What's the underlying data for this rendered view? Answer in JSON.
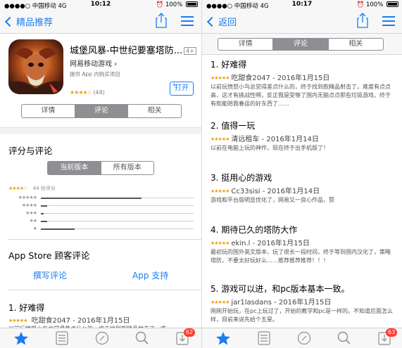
{
  "status_left": {
    "carrier": "●●●●○ 中国移动  4G",
    "time": "10:12",
    "battery": "100%"
  },
  "status_right": {
    "carrier": "●●●●○ 中国移动  4G",
    "time": "10:17",
    "battery": "100%"
  },
  "left": {
    "back_label": "精品推荐",
    "app": {
      "title": "城堡风暴-中世纪要塞塔防...",
      "age": "4+",
      "developer": "网易移动游戏 ›",
      "iap": "提供 App 内购买项目",
      "stars": "★★★★☆",
      "rating_count": "(44)",
      "open_label": "打开"
    },
    "tabs": [
      "详情",
      "评论",
      "相关"
    ],
    "ratings_heading": "评分与评论",
    "version_tabs": [
      "当前版本",
      "所有版本"
    ],
    "summary_stars": "★★★★☆",
    "summary_count": "44 份评分",
    "histogram": [
      {
        "stars": "★★★★★",
        "fraction": 0.66
      },
      {
        "stars": "★★★★",
        "fraction": 0.04
      },
      {
        "stars": "★★★",
        "fraction": 0.02
      },
      {
        "stars": "★★",
        "fraction": 0.04
      },
      {
        "stars": "★",
        "fraction": 0.22
      }
    ],
    "customer_reviews_heading": "App Store 顾客评论",
    "write_review": "撰写评论",
    "app_support": "App 支持",
    "review1_title": "1. 好难得",
    "review1_meta": "吃甜食2047 - 2016年1月15日",
    "review1_body_fragment": "以前玩愤怒小鸟总觉得差点什么的，终于找到款精品射击了。难"
  },
  "right": {
    "back_label": "返回",
    "tabs": [
      "详情",
      "评论",
      "相关"
    ],
    "reviews": [
      {
        "title": "1. 好难得",
        "meta": "吃甜食2047 - 2016年1月15日",
        "body": "以前玩愤怒小鸟总觉得差点什么的，终于找到款精品射击了。难度有点点高，这才有挑战性啊，反正我是受够了国内无脑点点那些垃圾游戏，终于有款能陪我春运的好东西了……"
      },
      {
        "title": "2. 值得一玩",
        "meta": "清远租车 - 2016年1月14日",
        "body": "以前在电脑上玩的神作，现在终于出手机版了！"
      },
      {
        "title": "3. 挺用心的游戏",
        "meta": "Cc33sisi - 2016年1月14日",
        "body": "游戏和平台版明显优化了，网易又一良心作品，赞"
      },
      {
        "title": "4. 期待已久的塔防大作",
        "meta": "ekin.l - 2016年1月15日",
        "body": "最初玩的国外英文版本，玩了很长一段时间，终于等到国内汉化了，策略塔防，不要太好玩好么……推荐推荐推荐！！！"
      },
      {
        "title": "5. 游戏可以进，和pc版本基本一致。",
        "meta": "jar1lasdans - 2016年1月15日",
        "body": "刚刚开始玩，在pc上玩过了，开始的教学和pc是一样的。不知道后面怎么样，目前来说先给个五星。"
      }
    ],
    "review_stars": "★★★★★"
  },
  "tabbar_left_badge": "62",
  "tabbar_right_badge": "63",
  "colors": {
    "accent": "#1a7cf4",
    "star": "#f29b0c",
    "badge": "#ff3b30"
  }
}
